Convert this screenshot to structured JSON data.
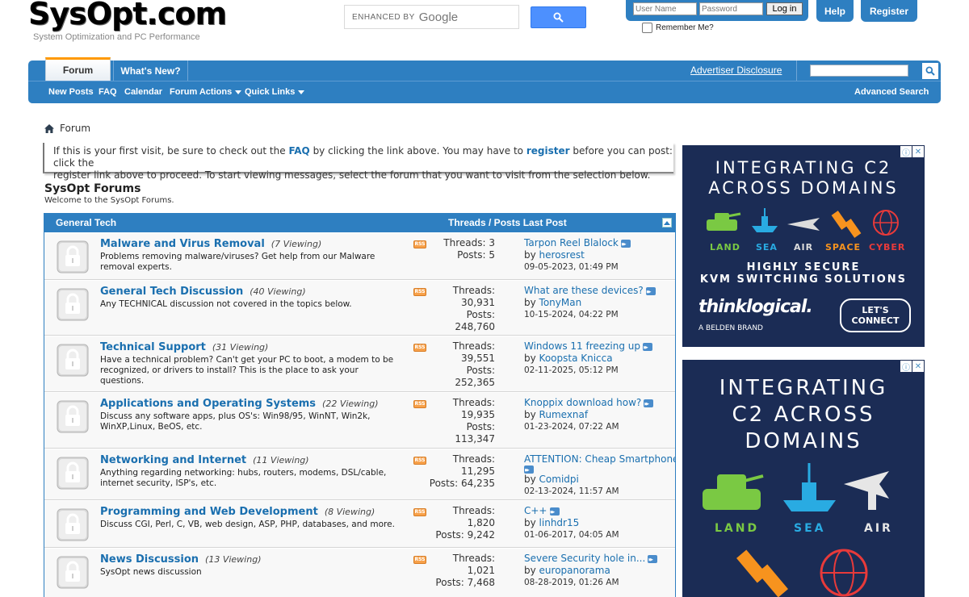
{
  "header": {
    "logo": "SysOpt.com",
    "tagline": "System Optimization and PC Performance",
    "search_enhanced": "ENHANCED BY",
    "search_brand": "Google",
    "login": {
      "username_placeholder": "User Name",
      "password_placeholder": "Password",
      "login_label": "Log in",
      "remember_label": "Remember Me?"
    },
    "help_label": "Help",
    "register_label": "Register"
  },
  "nav": {
    "tabs": [
      "Forum",
      "What's New?"
    ],
    "advertiser": "Advertiser Disclosure",
    "advanced_search": "Advanced Search",
    "sub": [
      "New Posts",
      "FAQ",
      "Calendar",
      "Forum Actions",
      "Quick Links"
    ]
  },
  "breadcrumb": "Forum",
  "notice": {
    "p1": "If this is your first visit, be sure to check out the ",
    "faq": "FAQ",
    "p2": " by clicking the link above. You may have to ",
    "register": "register",
    "p3": " before you can post: click the",
    "line2": "register link above to proceed. To start viewing messages, select the forum that you want to visit from the selection below."
  },
  "forum": {
    "title": "SysOpt Forums",
    "subtitle": "Welcome to the SysOpt Forums.",
    "section": "General Tech",
    "columns": "Threads / Posts Last Post",
    "rows": [
      {
        "name": "Malware and Virus Removal",
        "viewing": "(7 Viewing)",
        "desc": "Problems removing malware/viruses? Get help from our Malware removal experts.",
        "threads_label": "Threads: 3",
        "posts_label": "Posts: 5",
        "last_title": "Tarpon Reel Blalock",
        "last_by": "by",
        "last_user": "herosrest",
        "last_date": "09-05-2023, 01:49 PM"
      },
      {
        "name": "General Tech Discussion",
        "viewing": "(40 Viewing)",
        "desc": "Any TECHNICAL discussion not covered in the topics below.",
        "threads_label": "Threads:",
        "threads": "30,931",
        "posts_label": "Posts:",
        "posts": "248,760",
        "last_title": "What are these devices?",
        "last_by": "by",
        "last_user": "TonyMan",
        "last_date": "10-15-2024, 04:22 PM"
      },
      {
        "name": "Technical Support",
        "viewing": "(31 Viewing)",
        "desc": "Have a technical problem? Can't get your PC to boot, a modem to be recognized, or drivers to install? This is the place to ask your questions.",
        "threads_label": "Threads:",
        "threads": "39,551",
        "posts_label": "Posts:",
        "posts": "252,365",
        "last_title": "Windows 11 freezing up",
        "last_by": "by",
        "last_user": "Koopsta Knicca",
        "last_date": "02-11-2025, 05:12 PM"
      },
      {
        "name": "Applications and Operating Systems",
        "viewing": "(22 Viewing)",
        "desc": "Discuss any software apps, plus OS's: Win98/95, WinNT, Win2k, WinXP,Linux, BeOS, etc.",
        "threads_label": "Threads:",
        "threads": "19,935",
        "posts_label": "Posts:",
        "posts": "113,347",
        "last_title": "Knoppix download how?",
        "last_by": "by",
        "last_user": "Rumexnaf",
        "last_date": "01-23-2024, 07:22 AM"
      },
      {
        "name": "Networking and Internet",
        "viewing": "(11 Viewing)",
        "desc": "Anything regarding networking: hubs, routers, modems, DSL/cable, internet security, ISP's, etc.",
        "threads_label": "Threads:",
        "threads": "11,295",
        "posts_label": "Posts: 64,235",
        "last_title": "ATTENTION: Cheap Smartphone...",
        "last_by": "by",
        "last_user": "Comidpi",
        "last_date": "02-13-2024, 11:57 AM"
      },
      {
        "name": "Programming and Web Development",
        "viewing": "(8 Viewing)",
        "desc": "Discuss CGI, Perl, C, VB, web design, ASP, PHP, databases, and more.",
        "threads_label": "Threads:",
        "threads": "1,820",
        "posts_label": "Posts: 9,242",
        "last_title": "C++",
        "last_by": "by",
        "last_user": "linhdr15",
        "last_date": "01-06-2017, 04:05 AM"
      },
      {
        "name": "News Discussion",
        "viewing": "(13 Viewing)",
        "desc": "SysOpt news discussion",
        "threads_label": "Threads:",
        "threads": "1,021",
        "posts_label": "Posts: 7,468",
        "last_title": "Severe Security hole in...",
        "last_by": "by",
        "last_user": "europanorama",
        "last_date": "08-28-2019, 01:26 AM"
      }
    ]
  },
  "ads": {
    "ad1": {
      "headline1": "INTEGRATING C2",
      "headline2": "ACROSS DOMAINS",
      "domains": [
        "LAND",
        "SEA",
        "AIR",
        "SPACE",
        "CYBER"
      ],
      "tag1": "HIGHLY SECURE",
      "tag2": "KVM SWITCHING SOLUTIONS",
      "brand": "thinklogical.",
      "sub_brand": "A BELDEN BRAND",
      "cta": "LET'S CONNECT"
    },
    "ad2": {
      "headline1": "INTEGRATING",
      "headline2": "C2 ACROSS",
      "headline3": "DOMAINS",
      "domains": [
        "LAND",
        "SEA",
        "AIR"
      ]
    }
  },
  "colors": {
    "nav_blue": "#2e7fc1",
    "link_blue": "#1a6faf",
    "ad_navy": "#1b2c55",
    "land": "#7ac943",
    "sea": "#29abe2",
    "space": "#f7931e",
    "cyber": "#e83a3a"
  }
}
